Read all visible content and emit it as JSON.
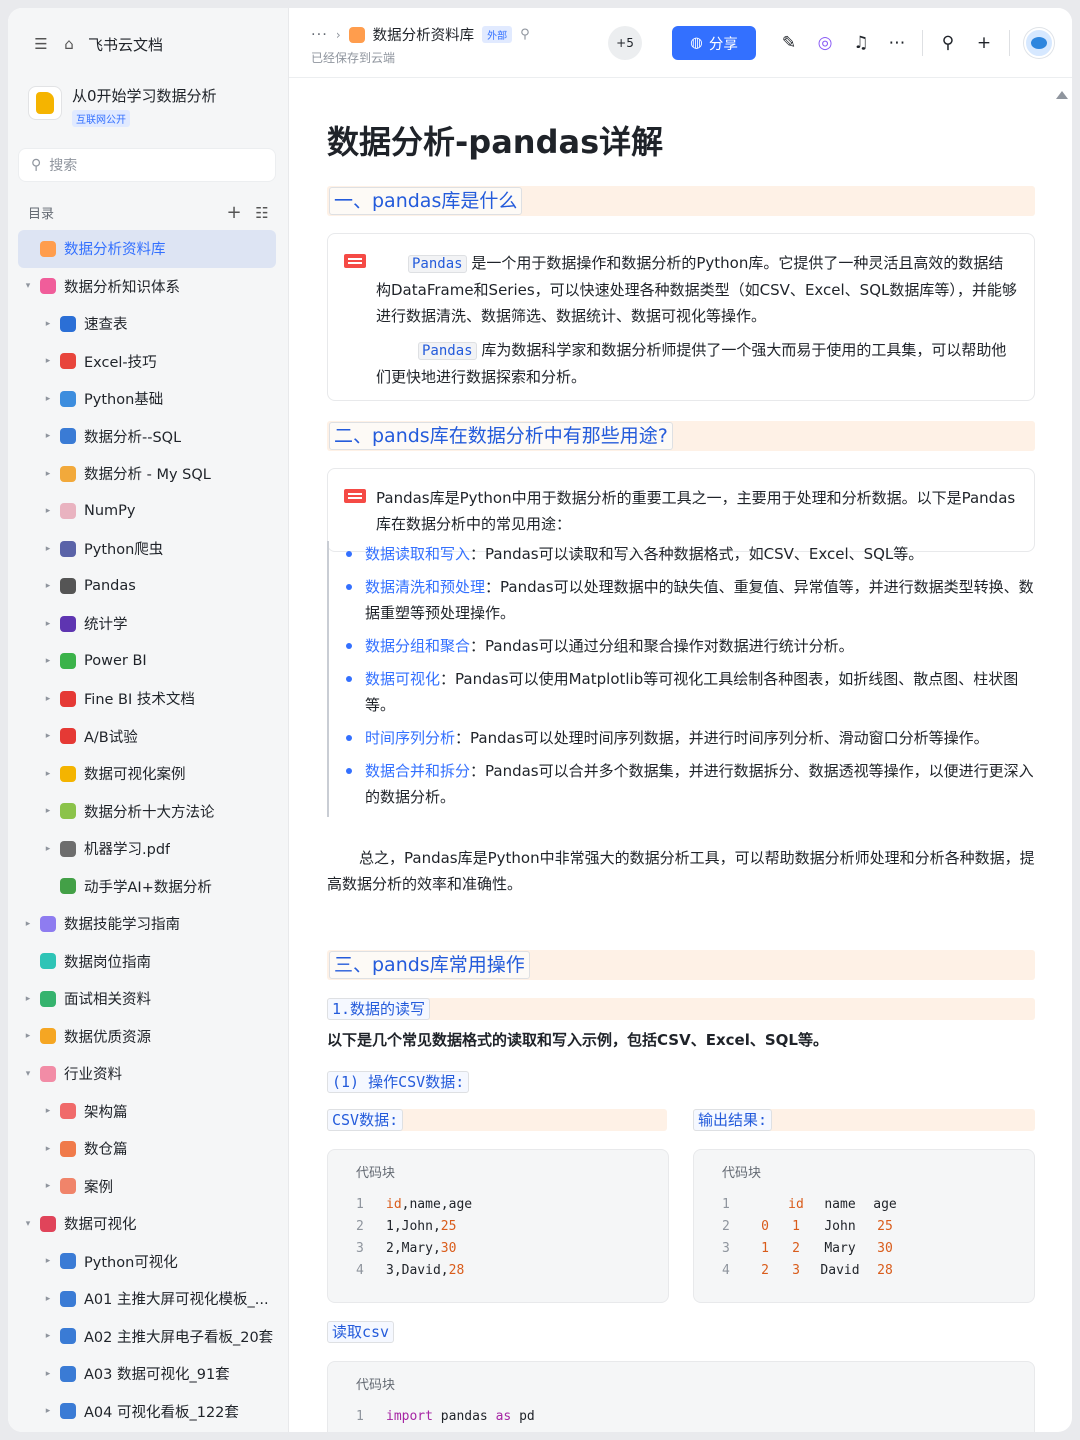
{
  "sidebar": {
    "app_name": "飞书云文档",
    "workspace": {
      "title": "从0开始学习数据分析",
      "tag": "互联网公开"
    },
    "search_placeholder": "搜索",
    "toc_label": "目录",
    "items": [
      {
        "label": "数据分析资料库",
        "level": 0,
        "arrow": "",
        "icon_color": "#ff9d4d",
        "active": true
      },
      {
        "label": "数据分析知识体系",
        "level": 0,
        "arrow": "▾",
        "icon_color": "#f05d9a"
      },
      {
        "label": "速查表",
        "level": 1,
        "arrow": "▸",
        "icon_color": "#2b6fd6"
      },
      {
        "label": "Excel-技巧",
        "level": 1,
        "arrow": "▸",
        "icon_color": "#e8453c"
      },
      {
        "label": "Python基础",
        "level": 1,
        "arrow": "▸",
        "icon_color": "#3c8dde"
      },
      {
        "label": "数据分析--SQL",
        "level": 1,
        "arrow": "▸",
        "icon_color": "#3a7bd5"
      },
      {
        "label": "数据分析 - My SQL",
        "level": 1,
        "arrow": "▸",
        "icon_color": "#f2a93b"
      },
      {
        "label": "NumPy",
        "level": 1,
        "arrow": "▸",
        "icon_color": "#e9b3c0"
      },
      {
        "label": "Python爬虫",
        "level": 1,
        "arrow": "▸",
        "icon_color": "#5a63a8"
      },
      {
        "label": "Pandas",
        "level": 1,
        "arrow": "▸",
        "icon_color": "#555555"
      },
      {
        "label": "统计学",
        "level": 1,
        "arrow": "▸",
        "icon_color": "#5e35b1"
      },
      {
        "label": "Power BI",
        "level": 1,
        "arrow": "▸",
        "icon_color": "#3bb34a"
      },
      {
        "label": "Fine BI 技术文档",
        "level": 1,
        "arrow": "▸",
        "icon_color": "#e53935"
      },
      {
        "label": "A/B试验",
        "level": 1,
        "arrow": "▸",
        "icon_color": "#e53935"
      },
      {
        "label": "数据可视化案例",
        "level": 1,
        "arrow": "▸",
        "icon_color": "#f4b400"
      },
      {
        "label": "数据分析十大方法论",
        "level": 1,
        "arrow": "▸",
        "icon_color": "#8bc34a"
      },
      {
        "label": "机器学习.pdf",
        "level": 1,
        "arrow": "▸",
        "icon_color": "#6d6d6d"
      },
      {
        "label": "动手学AI+数据分析",
        "level": 1,
        "arrow": "",
        "icon_color": "#43a047"
      },
      {
        "label": "数据技能学习指南",
        "level": 0,
        "arrow": "▸",
        "icon_color": "#8e7cf0"
      },
      {
        "label": "数据岗位指南",
        "level": 0,
        "arrow": "",
        "icon_color": "#2ec4b6"
      },
      {
        "label": "面试相关资料",
        "level": 0,
        "arrow": "▸",
        "icon_color": "#35b36e"
      },
      {
        "label": "数据优质资源",
        "level": 0,
        "arrow": "▸",
        "icon_color": "#f5a623"
      },
      {
        "label": "行业资料",
        "level": 0,
        "arrow": "▾",
        "icon_color": "#f28ca6"
      },
      {
        "label": "架构篇",
        "level": 1,
        "arrow": "▸",
        "icon_color": "#f06a6a"
      },
      {
        "label": "数仓篇",
        "level": 1,
        "arrow": "▸",
        "icon_color": "#f07a4a"
      },
      {
        "label": "案例",
        "level": 1,
        "arrow": "▸",
        "icon_color": "#f0846a"
      },
      {
        "label": "数据可视化",
        "level": 0,
        "arrow": "▾",
        "icon_color": "#e0445a"
      },
      {
        "label": "Python可视化",
        "level": 1,
        "arrow": "▸",
        "icon_color": "#3a7bd5"
      },
      {
        "label": "A01 主推大屏可视化模板_...",
        "level": 1,
        "arrow": "▸",
        "icon_color": "#3a7bd5"
      },
      {
        "label": "A02 主推大屏电子看板_20套",
        "level": 1,
        "arrow": "▸",
        "icon_color": "#3a7bd5"
      },
      {
        "label": "A03 数据可视化_91套",
        "level": 1,
        "arrow": "▸",
        "icon_color": "#3a7bd5"
      },
      {
        "label": "A04 可视化看板_122套",
        "level": 1,
        "arrow": "▸",
        "icon_color": "#3a7bd5"
      }
    ]
  },
  "header": {
    "crumb_dots": "···",
    "doc_name": "数据分析资料库",
    "tag": "外部",
    "saved": "已经保存到云端",
    "collaborators": "+5",
    "share_label": "分享"
  },
  "doc": {
    "title": "数据分析-pandas详解",
    "s1_title": "一、pandas库是什么",
    "s1_p1_code": "Pandas",
    "s1_p1_text": " 是一个用于数据操作和数据分析的Python库。它提供了一种灵活且高效的数据结构DataFrame和Series，可以快速处理各种数据类型（如CSV、Excel、SQL数据库等），并能够进行数据清洗、数据筛选、数据统计、数据可视化等操作。",
    "s1_p2_code": "Pandas",
    "s1_p2_text": " 库为数据科学家和数据分析师提供了一个强大而易于使用的工具集，可以帮助他们更快地进行数据探索和分析。",
    "s2_title": "二、pands库在数据分析中有那些用途?",
    "s2_callout": "Pandas库是Python中用于数据分析的重要工具之一，主要用于处理和分析数据。以下是Pandas库在数据分析中的常见用途：",
    "uses": [
      {
        "key": "数据读取和写入",
        "text": "：Pandas可以读取和写入各种数据格式，如CSV、Excel、SQL等。"
      },
      {
        "key": "数据清洗和预处理",
        "text": "：Pandas可以处理数据中的缺失值、重复值、异常值等，并进行数据类型转换、数据重塑等预处理操作。"
      },
      {
        "key": "数据分组和聚合",
        "text": "：Pandas可以通过分组和聚合操作对数据进行统计分析。"
      },
      {
        "key": "数据可视化",
        "text": "：Pandas可以使用Matplotlib等可视化工具绘制各种图表，如折线图、散点图、柱状图等。"
      },
      {
        "key": "时间序列分析",
        "text": "：Pandas可以处理时间序列数据，并进行时间序列分析、滑动窗口分析等操作。"
      },
      {
        "key": "数据合并和拆分",
        "text": "：Pandas可以合并多个数据集，并进行数据拆分、数据透视等操作，以便进行更深入的数据分析。"
      }
    ],
    "summary": "总之，Pandas库是Python中非常强大的数据分析工具，可以帮助数据分析师处理和分析各种数据，提高数据分析的效率和准确性。",
    "s3_title": "三、pands库常用操作",
    "s3_sub": "1.数据的读写",
    "s3_intro": "以下是几个常见数据格式的读取和写入示例，包括CSV、Excel、SQL等。",
    "s3_csv_h": "(1) 操作CSV数据:",
    "csv_label": "CSV数据:",
    "out_label": "输出结果:",
    "code_caption": "代码块",
    "csv_lines": [
      {
        "n": "1",
        "a": "id",
        "b": ",name,age"
      },
      {
        "n": "2",
        "a": "1,John,",
        "b": "25"
      },
      {
        "n": "3",
        "a": "2,Mary,",
        "b": "30"
      },
      {
        "n": "4",
        "a": "3,David,",
        "b": "28"
      }
    ],
    "out_lines": [
      {
        "n": "1",
        "c": [
          "",
          "id",
          "name",
          "age"
        ]
      },
      {
        "n": "2",
        "c": [
          "0",
          "1",
          "John",
          "25"
        ]
      },
      {
        "n": "3",
        "c": [
          "1",
          "2",
          "Mary",
          "30"
        ]
      },
      {
        "n": "4",
        "c": [
          "2",
          "3",
          "David",
          "28"
        ]
      }
    ],
    "read_label": "读取csv",
    "read_line": {
      "n": "1",
      "kw1": "import",
      "mid": " pandas ",
      "kw2": "as",
      "end": " pd"
    }
  }
}
